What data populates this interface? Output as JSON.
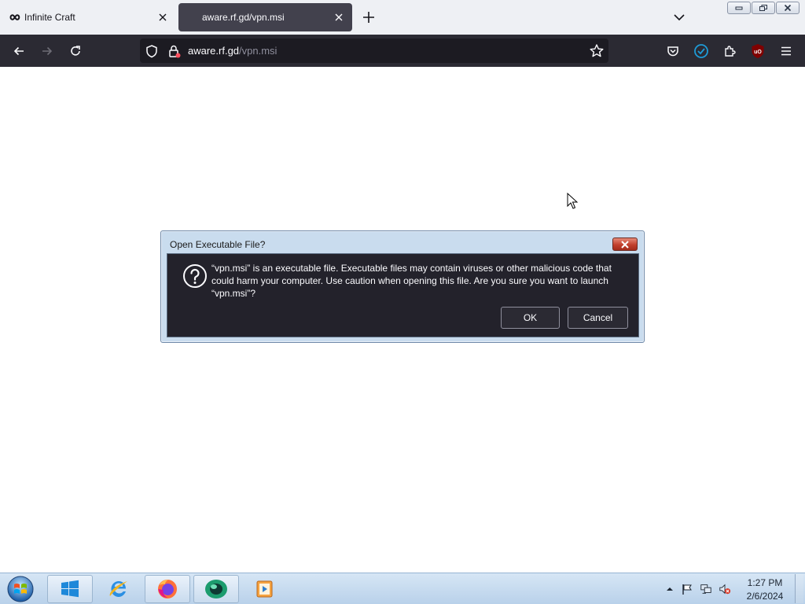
{
  "browser": {
    "tabs": [
      {
        "label": "Infinite Craft",
        "favicon": "infinity-icon",
        "active": false
      },
      {
        "label": "aware.rf.gd/vpn.msi",
        "favicon": "none",
        "active": true
      }
    ],
    "url": {
      "host": "aware.rf.gd",
      "path": "/vpn.msi"
    },
    "toolbar_icons": [
      "back-icon",
      "forward-icon",
      "reload-icon",
      "shield-icon",
      "permissions-icon",
      "bookmark-star-icon",
      "pocket-icon",
      "extension-check-icon",
      "extensions-puzzle-icon",
      "ublock-icon",
      "menu-icon"
    ],
    "window_controls": [
      "minimize-icon",
      "restore-icon",
      "close-icon"
    ]
  },
  "dialog": {
    "title": "Open Executable File?",
    "message": "“vpn.msi” is an executable file. Executable files may contain viruses or other malicious code that could harm your computer. Use caution when opening this file. Are you sure you want to launch “vpn.msi”?",
    "icon": "question-icon",
    "ok_label": "OK",
    "cancel_label": "Cancel"
  },
  "taskbar": {
    "items": [
      "windows-start-icon",
      "windows-logo-icon",
      "internet-explorer-icon",
      "firefox-icon",
      "green-app-icon",
      "media-player-icon"
    ],
    "tray_icons": [
      "show-hidden-icons-icon",
      "action-center-flag-icon",
      "network-icon",
      "volume-muted-icon"
    ],
    "clock": {
      "time": "1:27 PM",
      "date": "2/6/2024"
    }
  },
  "colors": {
    "toolbar": "#2b2a33",
    "urlbar": "#1c1b22",
    "active_tab": "#42414d",
    "dialog_body": "#23222b",
    "dialog_frame": "#c9dcee",
    "close_button": "#c2402d",
    "ublock_red": "#800000",
    "check_blue": "#1e9bd7"
  }
}
